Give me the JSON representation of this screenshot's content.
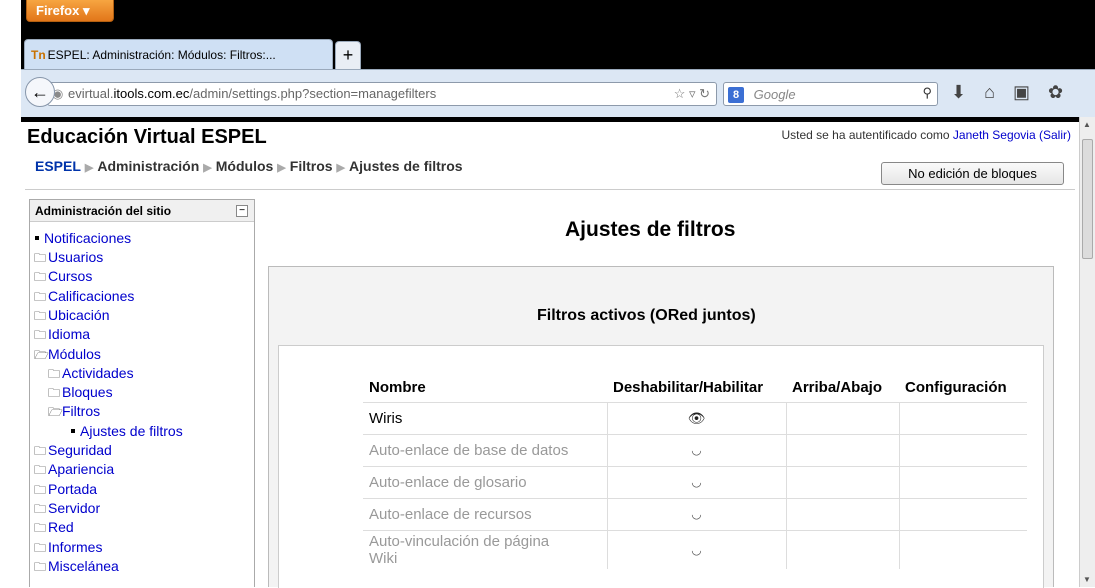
{
  "browser": {
    "menu_button": "Firefox",
    "tab_title": "ESPEL: Administración: Módulos: Filtros:...",
    "url_prefix": "evirtual.",
    "url_host": "itools.com.ec",
    "url_path": "/admin/settings.php?section=managefilters",
    "search_placeholder": "Google"
  },
  "header": {
    "site_title": "Educación Virtual ESPEL",
    "login_text": "Usted se ha autentificado como",
    "user_name": "Janeth Segovia",
    "logout_label": "(Salir)",
    "editing_button": "No edición de bloques"
  },
  "breadcrumb": [
    "ESPEL",
    "Administración",
    "Módulos",
    "Filtros",
    "Ajustes de filtros"
  ],
  "sidebar": {
    "title": "Administración del sitio",
    "items": [
      {
        "label": "Notificaciones",
        "icon": "bullet"
      },
      {
        "label": "Usuarios",
        "icon": "folder-icon"
      },
      {
        "label": "Cursos",
        "icon": "folder-icon"
      },
      {
        "label": "Calificaciones",
        "icon": "folder-icon"
      },
      {
        "label": "Ubicación",
        "icon": "folder-icon"
      },
      {
        "label": "Idioma",
        "icon": "folder-icon"
      },
      {
        "label": "Módulos",
        "icon": "folder-open-icon"
      },
      {
        "label": "Actividades",
        "icon": "folder-icon"
      },
      {
        "label": "Bloques",
        "icon": "folder-icon"
      },
      {
        "label": "Filtros",
        "icon": "folder-open-icon"
      },
      {
        "label": "Ajustes de filtros",
        "icon": "bullet"
      },
      {
        "label": "Seguridad",
        "icon": "folder-icon"
      },
      {
        "label": "Apariencia",
        "icon": "folder-icon"
      },
      {
        "label": "Portada",
        "icon": "folder-icon"
      },
      {
        "label": "Servidor",
        "icon": "folder-icon"
      },
      {
        "label": "Red",
        "icon": "folder-icon"
      },
      {
        "label": "Informes",
        "icon": "folder-icon"
      },
      {
        "label": "Miscelánea",
        "icon": "folder-icon"
      }
    ]
  },
  "main": {
    "title": "Ajustes de filtros",
    "section_title": "Filtros activos (ORed juntos)",
    "columns": [
      "Nombre",
      "Deshabilitar/Habilitar",
      "Arriba/Abajo",
      "Configuración"
    ],
    "rows": [
      {
        "name": "Wiris",
        "state": "enabled",
        "icon": "eye-open-icon"
      },
      {
        "name": "Auto-enlace de base de datos",
        "state": "disabled",
        "icon": "eye-closed-icon"
      },
      {
        "name": "Auto-enlace de glosario",
        "state": "disabled",
        "icon": "eye-closed-icon"
      },
      {
        "name": "Auto-enlace de recursos",
        "state": "disabled",
        "icon": "eye-closed-icon"
      },
      {
        "name": "Auto-vinculación de página Wiki",
        "state": "disabled",
        "icon": "eye-closed-icon"
      }
    ]
  }
}
